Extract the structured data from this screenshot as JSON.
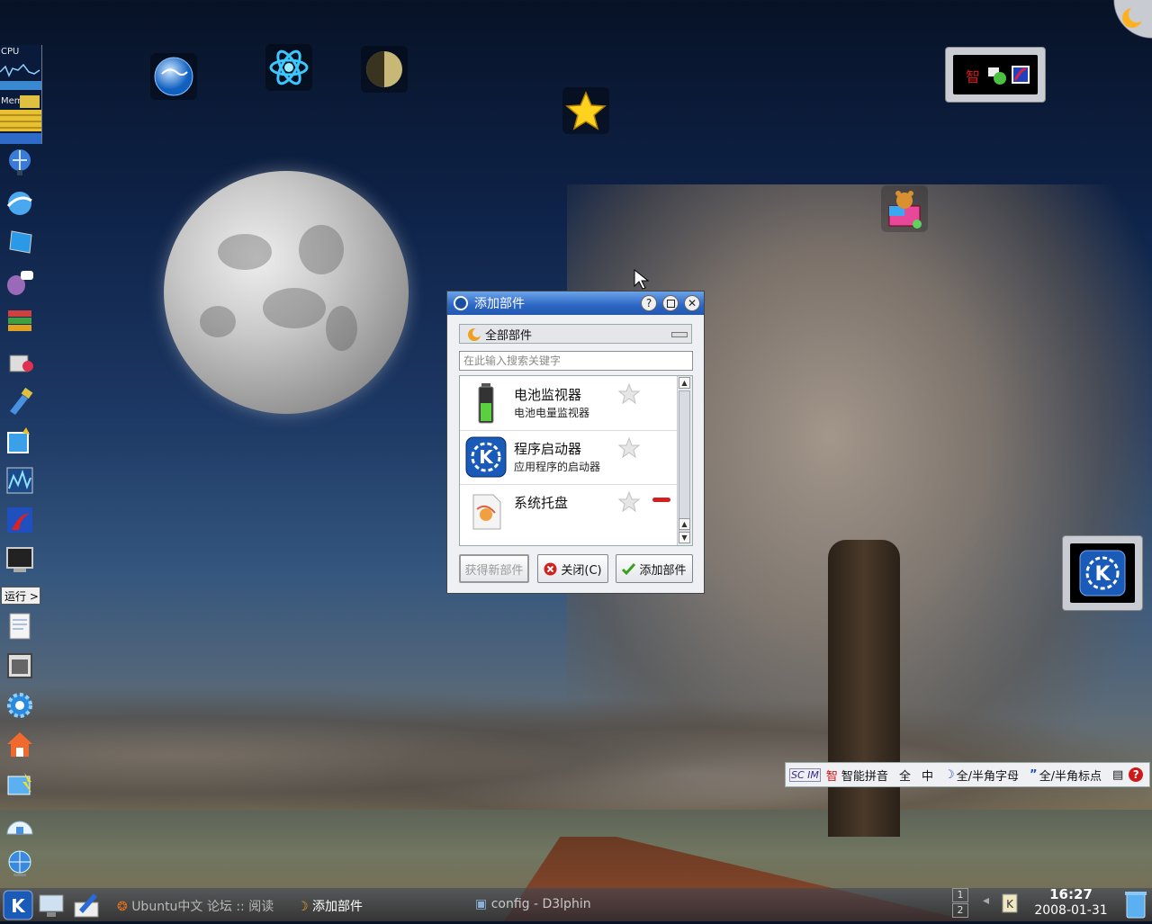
{
  "desktop": {
    "icons": [
      "globe-icon",
      "atom-icon",
      "moon-phase-icon",
      "star-icon",
      "toy-bear-icon"
    ]
  },
  "left_panel": {
    "cpu_label": "CPU",
    "mem_label": "Mem",
    "run_label": "运行 >"
  },
  "dialog": {
    "title": "添加部件",
    "category_label": "全部部件",
    "search_placeholder": "在此输入搜索关键字",
    "items": [
      {
        "name": "电池监视器",
        "desc": "电池电量监视器"
      },
      {
        "name": "程序启动器",
        "desc": "应用程序的启动器"
      },
      {
        "name": "系统托盘",
        "desc": ""
      }
    ],
    "get_new_label": "获得新部件",
    "close_label": "关闭(C)",
    "add_label": "添加部件"
  },
  "ime_bar": {
    "logo": "SC IM",
    "zhi": "智",
    "mode_label": "智能拼音",
    "full_label": "全",
    "zh_label": "中",
    "letters_label": "全/半角字母",
    "punct_label": "全/半角标点"
  },
  "taskbar": {
    "tasks": [
      {
        "label": "Ubuntu中文 论坛 :: 阅读"
      },
      {
        "label": "添加部件"
      },
      {
        "label": "config - D3lphin"
      }
    ],
    "pager": [
      "1",
      "2"
    ],
    "time": "16:27",
    "date": "2008-01-31"
  },
  "colors": {
    "title_bar": "#2b66c4",
    "accent": "#1a4fa0",
    "remove_red": "#d02020"
  }
}
